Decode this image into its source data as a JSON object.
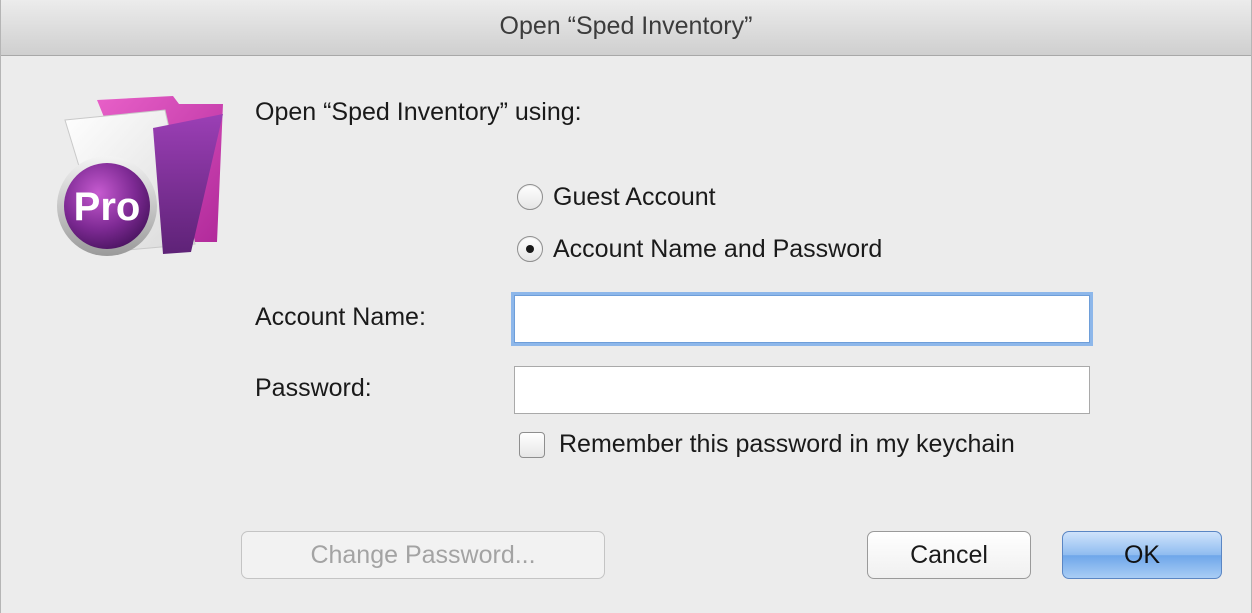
{
  "window": {
    "title": "Open “Sped Inventory”"
  },
  "app_icon": {
    "badge_text": "Pro"
  },
  "prompt": {
    "text": "Open “Sped Inventory” using:"
  },
  "login_options": [
    {
      "label": "Guest Account",
      "selected": false
    },
    {
      "label": "Account Name and Password",
      "selected": true
    }
  ],
  "fields": {
    "account_name_label": "Account Name:",
    "account_name_value": "",
    "password_label": "Password:",
    "password_value": ""
  },
  "remember": {
    "label": "Remember this password in my keychain",
    "checked": false
  },
  "buttons": {
    "change_password": "Change Password...",
    "cancel": "Cancel",
    "ok": "OK"
  },
  "colors": {
    "focus_ring": "#8db7ea",
    "default_button": "#6ea6ea",
    "icon_magenta": "#d63fb4",
    "icon_purple": "#7a2f8f"
  }
}
